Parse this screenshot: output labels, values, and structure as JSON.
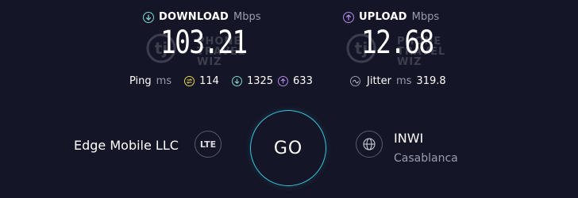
{
  "colors": {
    "background": "#141526",
    "download_accent": "#7dd9cb",
    "upload_accent": "#b48ae8",
    "ping_accent": "#e6d350",
    "go_ring": "#34c6df",
    "muted_text": "#9c9caf"
  },
  "download": {
    "icon": "arrow-down-circle-icon",
    "label": "DOWNLOAD",
    "unit": "Mbps",
    "value": "103.21"
  },
  "upload": {
    "icon": "arrow-up-circle-icon",
    "label": "UPLOAD",
    "unit": "Mbps",
    "value": "12.68"
  },
  "watermark": {
    "logo": "tj",
    "line1": "PHONE",
    "line2": "TRAVEL",
    "line3": "WIZ"
  },
  "ping": {
    "label": "Ping",
    "unit": "ms",
    "idle_icon": "ping-idle-icon",
    "idle": "114",
    "down_icon": "arrow-down-circle-icon",
    "down": "1325",
    "up_icon": "arrow-up-circle-icon",
    "up": "633"
  },
  "jitter": {
    "icon": "jitter-wave-icon",
    "label": "Jitter",
    "unit": "ms",
    "value": "319.8"
  },
  "provider": {
    "name": "Edge Mobile LLC",
    "connection_badge": "LTE"
  },
  "go_button": {
    "label": "GO"
  },
  "server": {
    "icon": "globe-icon",
    "name": "INWI",
    "location": "Casablanca"
  }
}
